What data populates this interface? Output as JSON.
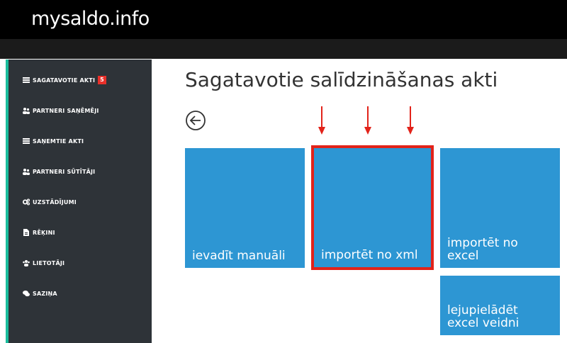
{
  "header": {
    "brand": "mysaldo.info"
  },
  "sidebar": {
    "accent": "#1abc9c",
    "items": [
      {
        "label": "SAGATAVOTIE AKTI",
        "icon": "list-icon",
        "badge": "5"
      },
      {
        "label": "PARTNERI SAŅĒMĒJI",
        "icon": "users-icon"
      },
      {
        "label": "SAŅEMTIE AKTI",
        "icon": "list-icon"
      },
      {
        "label": "PARTNERI SŪTĪTĀJI",
        "icon": "users-icon"
      },
      {
        "label": "UZSTĀDĪJUMI",
        "icon": "gears-icon"
      },
      {
        "label": "RĒĶINI",
        "icon": "file-icon"
      },
      {
        "label": "LIETOTĀJI",
        "icon": "user-group-icon"
      },
      {
        "label": "SAZIŅA",
        "icon": "chat-icon"
      }
    ]
  },
  "main": {
    "title": "Sagatavotie salīdzināšanas akti",
    "back_icon": "arrow-left-circle-icon",
    "tiles": [
      {
        "label": "ievadīt manuāli"
      },
      {
        "label": "importēt no xml",
        "highlighted": true
      },
      {
        "label": "importēt no excel"
      },
      {
        "label": "lejupielādēt excel veidni"
      }
    ]
  },
  "colors": {
    "tile": "#2d96d3",
    "highlight": "#e2231a",
    "sidebar": "#2e3338",
    "badge": "#e8302a"
  }
}
